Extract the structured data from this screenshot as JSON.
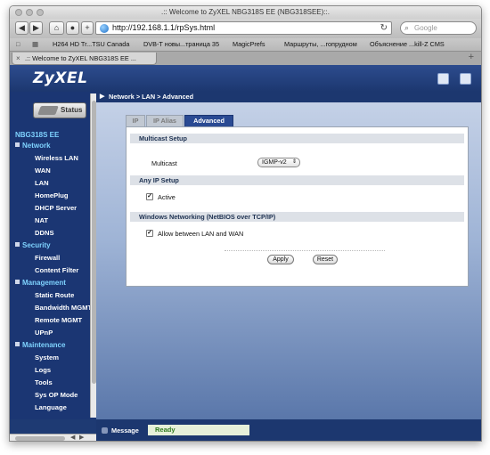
{
  "window": {
    "title": ".:: Welcome to ZyXEL NBG318S EE (NBG318SEE)::."
  },
  "toolbar": {
    "back_icon": "back-arrow",
    "forward_icon": "forward-arrow",
    "url": "http://192.168.1.1/rpSys.html",
    "search_placeholder": "Google"
  },
  "bookmarks": [
    "H264 HD Tr...TSU Canada",
    "DVB-T новы...траница 35",
    "MagicPrefs",
    "Маршруты, ...гопрудном",
    "Объяснение ...kill-Z CMS"
  ],
  "browser_tab": {
    "title": ".:: Welcome to ZyXEL NBG318S EE ..."
  },
  "router": {
    "logo": "ZyXEL",
    "status_button": "Status",
    "device_name": "NBG318S EE",
    "breadcrumb": "Network > LAN > Advanced"
  },
  "sidebar": {
    "sections": [
      {
        "label": "Network",
        "items": [
          "Wireless LAN",
          "WAN",
          "LAN",
          "HomePlug",
          "DHCP Server",
          "NAT",
          "DDNS"
        ]
      },
      {
        "label": "Security",
        "items": [
          "Firewall",
          "Content Filter"
        ]
      },
      {
        "label": "Management",
        "items": [
          "Static Route",
          "Bandwidth MGMT",
          "Remote MGMT",
          "UPnP"
        ]
      },
      {
        "label": "Maintenance",
        "items": [
          "System",
          "Logs",
          "Tools",
          "Sys OP Mode",
          "Language"
        ]
      }
    ]
  },
  "tabs": {
    "ip": "IP",
    "ip_alias": "IP Alias",
    "advanced": "Advanced",
    "active": "Advanced"
  },
  "form": {
    "multicast_header": "Multicast Setup",
    "multicast_label": "Multicast",
    "multicast_value": "IGMP-v2",
    "any_ip_header": "Any IP Setup",
    "active_label": "Active",
    "active_checked": true,
    "netbios_header": "Windows Networking (NetBIOS over TCP/IP)",
    "allow_label": "Allow between LAN and WAN",
    "allow_checked": true,
    "apply_label": "Apply",
    "reset_label": "Reset"
  },
  "status": {
    "message_label": "Message",
    "message_value": "Ready"
  },
  "colors": {
    "brand_blue": "#1c376f",
    "nav_accent": "#7fd3ff",
    "active_tab": "#2a4a93",
    "ready_green": "#2f7a1f"
  }
}
